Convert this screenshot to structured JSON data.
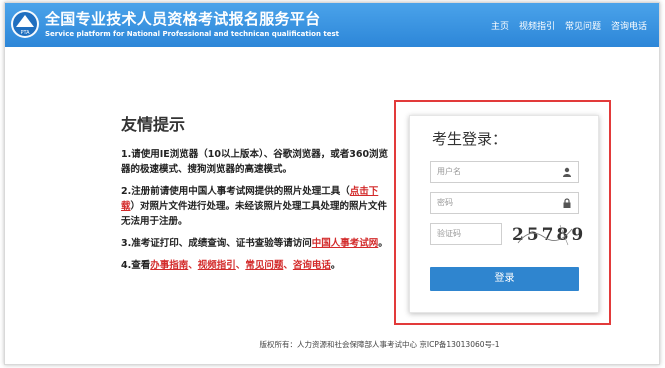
{
  "header": {
    "title": "全国专业技术人员资格考试报名服务平台",
    "subtitle": "Service platform for National Professional and technican qualification test",
    "logo_text": "PTA",
    "nav": [
      "主页",
      "视频指引",
      "常见问题",
      "咨询电话"
    ]
  },
  "notice": {
    "title": "友情提示",
    "item1": {
      "prefix": "1.",
      "text": "请使用IE浏览器（10以上版本）、谷歌浏览器，或者360浏览器的极速模式、搜狗浏览器的高速模式。"
    },
    "item2": {
      "prefix": "2.",
      "before": "注册前请使用中国人事考试网提供的照片处理工具（",
      "link": "点击下载",
      "after": "）对照片文件进行处理。未经该照片处理工具处理的照片文件无法用于注册。"
    },
    "item3": {
      "prefix": "3.",
      "before": "准考证打印、成绩查询、证书查验等请访问",
      "link": "中国人事考试网",
      "after": "。"
    },
    "item4": {
      "prefix": "4.",
      "before": "查看",
      "links": [
        "办事指南",
        "视频指引",
        "常见问题",
        "咨询电话"
      ],
      "separator": "、",
      "after": "。"
    }
  },
  "login": {
    "title": "考生登录：",
    "username_placeholder": "用户名",
    "password_placeholder": "密码",
    "captcha_placeholder": "验证码",
    "captcha_text": "25789",
    "button_label": "登录"
  },
  "footer": {
    "text": "版权所有：人力资源和社会保障部人事考试中心 京ICP备13013060号-1"
  },
  "colors": {
    "header": "#2d86d8",
    "accent": "#2f85cf",
    "link": "#d32b2b",
    "highlight": "#e23a3a"
  }
}
